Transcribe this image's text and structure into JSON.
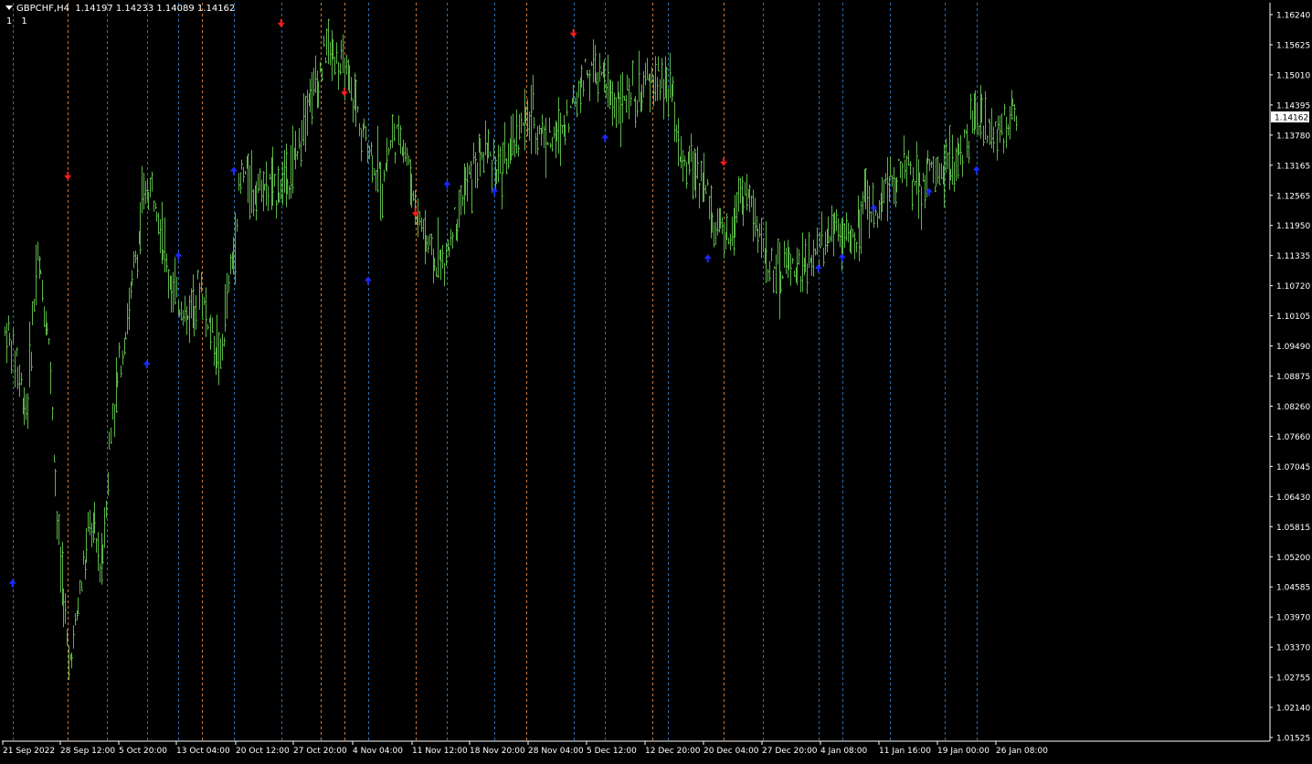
{
  "header": {
    "symbol": "GBPCHF,H4",
    "ohlc": "1.14197 1.14233 1.14089 1.14162",
    "sub_values": [
      "1",
      "1"
    ]
  },
  "chart_data": {
    "type": "line",
    "symbol": "GBPCHF",
    "timeframe": "H4",
    "ylim": [
      1.0155,
      1.1624
    ],
    "y_ticks": [
      "1.16240",
      "1.15625",
      "1.15010",
      "1.14395",
      "1.13780",
      "1.13165",
      "1.12565",
      "1.11950",
      "1.11335",
      "1.10720",
      "1.10105",
      "1.09490",
      "1.08875",
      "1.08260",
      "1.07660",
      "1.07045",
      "1.06430",
      "1.05815",
      "1.05200",
      "1.04585",
      "1.03970",
      "1.03370",
      "1.02755",
      "1.02140",
      "1.01525"
    ],
    "x_ticks": [
      "21 Sep 2022",
      "28 Sep 12:00",
      "5 Oct 20:00",
      "13 Oct 04:00",
      "20 Oct 12:00",
      "27 Oct 20:00",
      "4 Nov 04:00",
      "11 Nov 12:00",
      "18 Nov 20:00",
      "28 Nov 04:00",
      "5 Dec 12:00",
      "12 Dec 20:00",
      "20 Dec 04:00",
      "27 Dec 20:00",
      "4 Jan 08:00",
      "11 Jan 16:00",
      "19 Jan 00:00",
      "26 Jan 08:00"
    ],
    "current_price": "1.14162",
    "series": [
      {
        "color": "#5bb548",
        "x": [
          "21 Sep 2022",
          "22 Sep 2022",
          "23 Sep 2022",
          "26 Sep 2022",
          "26 Sep 2022",
          "27 Sep 2022",
          "28 Sep 2022",
          "29 Sep 2022",
          "30 Sep 2022",
          "3 Oct 2022",
          "4 Oct 2022",
          "5 Oct 2022",
          "6 Oct 2022",
          "7 Oct 2022",
          "10 Oct 2022",
          "11 Oct 2022",
          "12 Oct 2022",
          "12 Oct 2022",
          "13 Oct 2022",
          "14 Oct 2022",
          "17 Oct 2022",
          "18 Oct 2022",
          "19 Oct 2022",
          "20 Oct 2022",
          "21 Oct 2022",
          "24 Oct 2022",
          "25 Oct 2022",
          "26 Oct 2022",
          "27 Oct 2022",
          "28 Oct 2022",
          "31 Oct 2022",
          "1 Nov 2022",
          "2 Nov 2022",
          "3 Nov 2022",
          "4 Nov 2022",
          "7 Nov 2022",
          "8 Nov 2022",
          "9 Nov 2022",
          "10 Nov 2022",
          "11 Nov 2022",
          "14 Nov 2022",
          "15 Nov 2022",
          "16 Nov 2022",
          "17 Nov 2022",
          "18 Nov 2022",
          "21 Nov 2022",
          "22 Nov 2022",
          "23 Nov 2022",
          "24 Nov 2022",
          "25 Nov 2022",
          "28 Nov 2022",
          "29 Nov 2022",
          "30 Nov 2022",
          "1 Dec 2022",
          "2 Dec 2022",
          "5 Dec 2022",
          "6 Dec 2022",
          "7 Dec 2022",
          "8 Dec 2022",
          "9 Dec 2022",
          "12 Dec 2022",
          "13 Dec 2022",
          "14 Dec 2022",
          "15 Dec 2022",
          "16 Dec 2022",
          "19 Dec 2022",
          "20 Dec 2022",
          "21 Dec 2022",
          "22 Dec 2022",
          "23 Dec 2022",
          "26 Dec 2022",
          "27 Dec 2022",
          "28 Dec 2022",
          "29 Dec 2022",
          "30 Dec 2022",
          "2 Jan 2023",
          "3 Jan 2023",
          "4 Jan 2023",
          "5 Jan 2023",
          "6 Jan 2023",
          "9 Jan 2023",
          "10 Jan 2023",
          "11 Jan 2023",
          "12 Jan 2023",
          "13 Jan 2023",
          "16 Jan 2023",
          "17 Jan 2023",
          "18 Jan 2023",
          "19 Jan 2023",
          "20 Jan 2023",
          "23 Jan 2023",
          "24 Jan 2023",
          "25 Jan 2023",
          "26 Jan 2023",
          "27 Jan 2023"
        ],
        "values": [
          1.098,
          1.094,
          1.082,
          1.112,
          1.1,
          1.055,
          1.03,
          1.045,
          1.06,
          1.05,
          1.083,
          1.095,
          1.11,
          1.126,
          1.127,
          1.112,
          1.105,
          1.101,
          1.108,
          1.1,
          1.092,
          1.11,
          1.13,
          1.128,
          1.128,
          1.127,
          1.128,
          1.133,
          1.145,
          1.15,
          1.156,
          1.152,
          1.15,
          1.14,
          1.135,
          1.128,
          1.137,
          1.138,
          1.125,
          1.118,
          1.112,
          1.112,
          1.123,
          1.128,
          1.132,
          1.134,
          1.13,
          1.135,
          1.14,
          1.142,
          1.138,
          1.136,
          1.14,
          1.145,
          1.151,
          1.15,
          1.147,
          1.145,
          1.145,
          1.146,
          1.148,
          1.149,
          1.145,
          1.13,
          1.133,
          1.128,
          1.12,
          1.115,
          1.124,
          1.126,
          1.118,
          1.112,
          1.11,
          1.112,
          1.11,
          1.111,
          1.115,
          1.12,
          1.118,
          1.115,
          1.124,
          1.122,
          1.128,
          1.131,
          1.131,
          1.129,
          1.13,
          1.129,
          1.131,
          1.135,
          1.141,
          1.14,
          1.138,
          1.14,
          1.142
        ]
      }
    ],
    "session_lines": [
      {
        "color": "blue",
        "at": "22 Sep 2022"
      },
      {
        "color": "orange",
        "at": "29 Sep 2022"
      },
      {
        "color": "blue",
        "at": "4 Oct 2022"
      },
      {
        "color": "blue",
        "at": "9 Oct 2022"
      },
      {
        "color": "blue",
        "at": "13 Oct 2022"
      },
      {
        "color": "orange",
        "at": "16 Oct 2022"
      },
      {
        "color": "blue",
        "at": "20 Oct 2022"
      },
      {
        "color": "blue",
        "at": "26 Oct 2022"
      },
      {
        "color": "orange",
        "at": "31 Oct 2022"
      },
      {
        "color": "orange",
        "at": "3 Nov 2022"
      },
      {
        "color": "blue",
        "at": "6 Nov 2022"
      },
      {
        "color": "orange",
        "at": "12 Nov 2022"
      },
      {
        "color": "blue",
        "at": "16 Nov 2022"
      },
      {
        "color": "blue",
        "at": "22 Nov 2022"
      },
      {
        "color": "orange",
        "at": "26 Nov 2022"
      },
      {
        "color": "blue",
        "at": "2 Dec 2022"
      },
      {
        "color": "blue",
        "at": "6 Dec 2022"
      },
      {
        "color": "orange",
        "at": "12 Dec 2022"
      },
      {
        "color": "blue",
        "at": "14 Dec 2022"
      },
      {
        "color": "orange",
        "at": "21 Dec 2022"
      },
      {
        "color": "blue",
        "at": "26 Dec 2022"
      },
      {
        "color": "blue",
        "at": "2 Jan 2023"
      },
      {
        "color": "blue",
        "at": "5 Jan 2023"
      },
      {
        "color": "blue",
        "at": "11 Jan 2023"
      },
      {
        "color": "blue",
        "at": "18 Jan 2023"
      },
      {
        "color": "blue",
        "at": "22 Jan 2023"
      }
    ],
    "signals": [
      {
        "dir": "down",
        "at": "29 Sep 2022",
        "price": 1.129
      },
      {
        "dir": "down",
        "at": "26 Oct 2022",
        "price": 1.16
      },
      {
        "dir": "down",
        "at": "3 Nov 2022",
        "price": 1.146
      },
      {
        "dir": "down",
        "at": "12 Nov 2022",
        "price": 1.1215
      },
      {
        "dir": "down",
        "at": "2 Dec 2022",
        "price": 1.158
      },
      {
        "dir": "down",
        "at": "21 Dec 2022",
        "price": 1.1318
      },
      {
        "dir": "up",
        "at": "22 Sep 2022",
        "price": 1.0475
      },
      {
        "dir": "up",
        "at": "9 Oct 2022",
        "price": 1.092
      },
      {
        "dir": "up",
        "at": "13 Oct 2022",
        "price": 1.114
      },
      {
        "dir": "up",
        "at": "20 Oct 2022",
        "price": 1.1313
      },
      {
        "dir": "up",
        "at": "6 Nov 2022",
        "price": 1.109
      },
      {
        "dir": "up",
        "at": "16 Nov 2022",
        "price": 1.1285
      },
      {
        "dir": "up",
        "at": "22 Nov 2022",
        "price": 1.1272
      },
      {
        "dir": "up",
        "at": "6 Dec 2022",
        "price": 1.138
      },
      {
        "dir": "up",
        "at": "19 Dec 2022",
        "price": 1.1135
      },
      {
        "dir": "up",
        "at": "2 Jan 2023",
        "price": 1.1115
      },
      {
        "dir": "up",
        "at": "5 Jan 2023",
        "price": 1.1137
      },
      {
        "dir": "up",
        "at": "9 Jan 2023",
        "price": 1.1237
      },
      {
        "dir": "up",
        "at": "16 Jan 2023",
        "price": 1.127
      },
      {
        "dir": "up",
        "at": "22 Jan 2023",
        "price": 1.1315
      }
    ],
    "grid": false,
    "colors": {
      "background": "#000000",
      "candles": "#5bb548",
      "axis": "#ffffff",
      "blue_lines": "#2f6fb0",
      "orange_lines": "#c8783a",
      "down_arrow": "#ff1a1a",
      "up_arrow": "#1a2bff"
    }
  }
}
